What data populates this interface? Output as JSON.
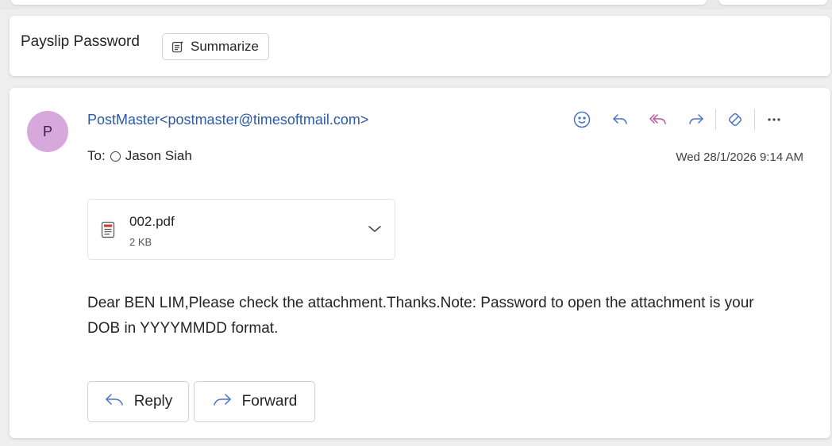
{
  "subject": {
    "title": "Payslip Password",
    "summarize_label": "Summarize"
  },
  "message": {
    "avatar_initial": "P",
    "sender": "PostMaster<postmaster@timesoftmail.com>",
    "to_label": "To:",
    "recipient": "Jason Siah",
    "date": "Wed 28/1/2026 9:14 AM",
    "actions": [
      "emoji-icon",
      "reply-icon",
      "reply-all-icon",
      "forward-icon",
      "apps-icon",
      "more-icon"
    ],
    "attachment": {
      "name": "002.pdf",
      "size": "2 KB",
      "icon": "pdf-file-icon"
    },
    "body": "Dear BEN LIM,Please check the attachment.Thanks.Note: Password to open the attachment is your DOB in YYYYMMDD format.",
    "reply_label": "Reply",
    "forward_label": "Forward"
  },
  "colors": {
    "accent": "#2b5aa8",
    "avatar_bg": "#d7a8db",
    "icon_blue": "#4a73c5"
  }
}
